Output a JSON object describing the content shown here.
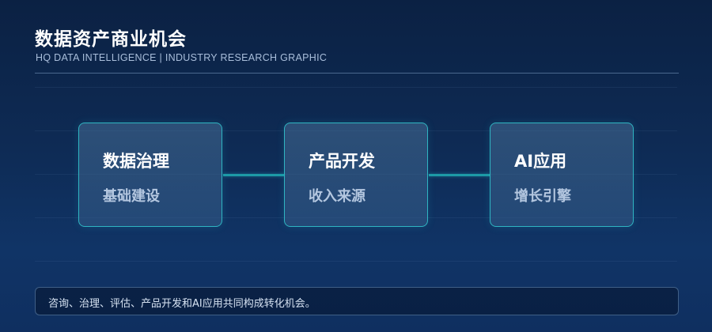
{
  "header": {
    "title": "数据资产商业机会",
    "subtitle": "HQ DATA INTELLIGENCE  |  INDUSTRY RESEARCH GRAPHIC"
  },
  "diagram": {
    "nodes": [
      {
        "title": "数据治理",
        "subtitle": "基础建设"
      },
      {
        "title": "产品开发",
        "subtitle": "收入来源"
      },
      {
        "title": "AI应用",
        "subtitle": "增长引擎"
      }
    ]
  },
  "footer": {
    "note": "咨询、治理、评估、产品开发和AI应用共同构成转化机会。"
  },
  "colors": {
    "accent": "#2fb4c2",
    "connector": "#1d9aa6",
    "background_top": "#0b2143",
    "background_bottom": "#0f2f60"
  }
}
